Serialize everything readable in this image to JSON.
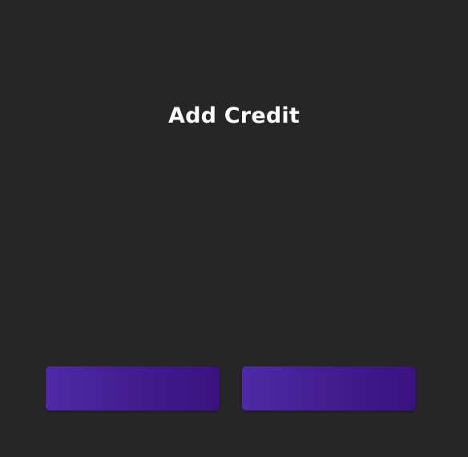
{
  "dialog": {
    "title": "Add Credit",
    "buttons": [
      {
        "label": ""
      },
      {
        "label": ""
      }
    ]
  },
  "colors": {
    "background": "#262626",
    "title_text": "#ffffff",
    "button_gradient_start": "#4e2aa6",
    "button_gradient_end": "#3a1280"
  }
}
